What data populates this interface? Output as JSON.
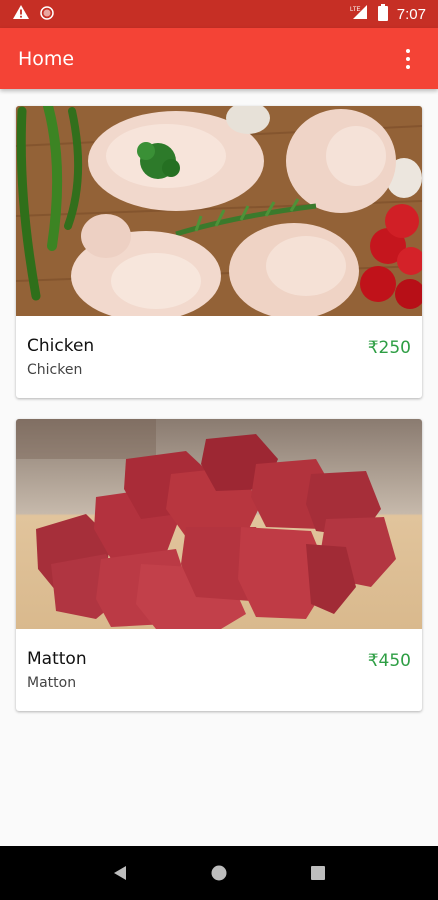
{
  "status_bar": {
    "time": "7:07",
    "icons": [
      "warning-icon",
      "notification-dot-icon",
      "signal-lte-icon",
      "battery-icon"
    ]
  },
  "app_bar": {
    "title": "Home",
    "menu_icon": "overflow-menu-icon"
  },
  "products": [
    {
      "title": "Chicken",
      "subtitle": "Chicken",
      "price": "₹250",
      "image": "raw-chicken-photo"
    },
    {
      "title": "Matton",
      "subtitle": "Matton",
      "price": "₹450",
      "image": "raw-mutton-photo"
    }
  ],
  "nav_bar": {
    "icons": [
      "back-icon",
      "home-icon",
      "recents-icon"
    ]
  },
  "colors": {
    "status_bar": "#c62f25",
    "app_bar": "#f44336",
    "price": "#2e9e44",
    "background": "#fafafa"
  }
}
